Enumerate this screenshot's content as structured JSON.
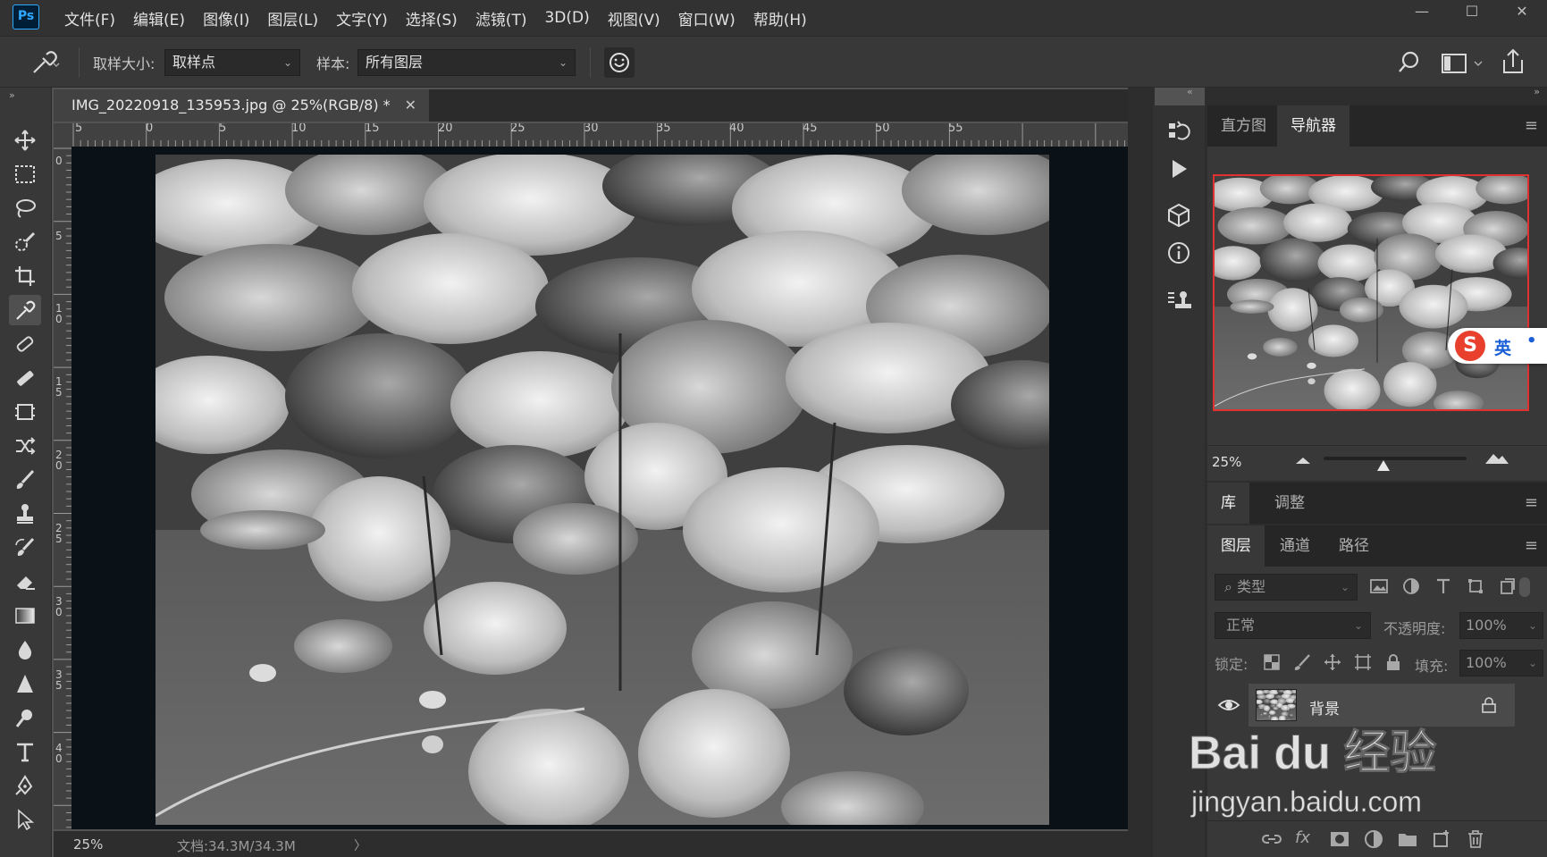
{
  "app": {
    "logo": "Ps"
  },
  "menu": [
    "文件(F)",
    "编辑(E)",
    "图像(I)",
    "图层(L)",
    "文字(Y)",
    "选择(S)",
    "滤镜(T)",
    "3D(D)",
    "视图(V)",
    "窗口(W)",
    "帮助(H)"
  ],
  "window_controls": {
    "minimize": "—",
    "maximize": "☐",
    "close": "✕"
  },
  "options": {
    "sample_size_label": "取样大小:",
    "sample_size_value": "取样点",
    "sample_label": "样本:",
    "sample_value": "所有图层"
  },
  "document": {
    "tab_title": "IMG_20220918_135953.jpg @ 25%(RGB/8) *",
    "close": "✕"
  },
  "ruler_h_labels": [
    "5",
    "0",
    "5",
    "10",
    "15",
    "20",
    "25",
    "30",
    "35",
    "40",
    "45",
    "50",
    "55"
  ],
  "ruler_v_labels": [
    "0",
    "5",
    "1\n0",
    "1\n5",
    "2\n0",
    "2\n5",
    "3\n0",
    "3\n5",
    "4\n0"
  ],
  "status": {
    "zoom": "25%",
    "doc_size": "文档:34.3M/34.3M",
    "arrow": "〉"
  },
  "navigator": {
    "tabs": [
      "直方图",
      "导航器"
    ],
    "active_tab": 1,
    "zoom": "25%",
    "zoom_slider_level": 0.42
  },
  "library_tabs": [
    "库",
    "调整"
  ],
  "layers": {
    "tabs": [
      "图层",
      "通道",
      "路径"
    ],
    "filter_placeholder": "类型",
    "blend_mode": "正常",
    "opacity_label": "不透明度:",
    "opacity_value": "100%",
    "lock_label": "锁定:",
    "fill_label": "填充:",
    "fill_value": "100%",
    "items": [
      {
        "name": "背景",
        "visible": true,
        "locked": true
      }
    ]
  },
  "ime": {
    "logo": "S",
    "text": "英"
  },
  "watermark": {
    "brand": "Bai du 经验",
    "url": "jingyan.baidu.com"
  },
  "colors": {
    "accent": "#31a8ff",
    "nav_border": "#e03131",
    "ime_red": "#e8402c"
  }
}
